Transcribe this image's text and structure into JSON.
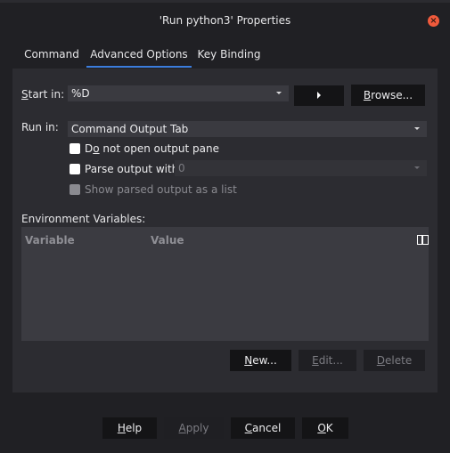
{
  "window": {
    "title": "'Run python3' Properties",
    "close_icon": "close-icon"
  },
  "tabs": [
    {
      "label": "Command",
      "active": false
    },
    {
      "label": "Advanced Options",
      "active": true
    },
    {
      "label": "Key Binding",
      "active": false
    }
  ],
  "start_in": {
    "label_pre": "",
    "label_mnemonic": "S",
    "label_post": "tart in:",
    "value": "%D",
    "arrow_button_icon": "play-arrow-icon",
    "browse_mnemonic": "B",
    "browse_rest": "rowse..."
  },
  "run_in": {
    "label": "Run in:",
    "value": "Command Output Tab"
  },
  "options": {
    "do_not_open": {
      "pre": "D",
      "mnemonic": "o",
      "post": " not open output pane",
      "checked": false
    },
    "parse_output": {
      "label": "Parse output with:",
      "checked": false,
      "value": "0"
    },
    "show_parsed": {
      "label": "Show parsed output as a list",
      "checked": false,
      "disabled": true
    }
  },
  "environment": {
    "label": "Environment Variables:",
    "columns": [
      "Variable",
      "Value"
    ],
    "rows": [],
    "columns_icon": "columns-icon",
    "buttons": {
      "new": {
        "mnemonic": "N",
        "rest": "ew..."
      },
      "edit": {
        "mnemonic": "E",
        "rest": "dit...",
        "disabled": true
      },
      "delete": {
        "mnemonic": "D",
        "rest": "elete",
        "disabled": true
      }
    }
  },
  "footer": {
    "help": {
      "mnemonic": "H",
      "rest": "elp"
    },
    "apply": {
      "mnemonic": "A",
      "rest": "pply",
      "disabled": true
    },
    "cancel": {
      "mnemonic": "C",
      "rest": "ancel"
    },
    "ok": {
      "mnemonic": "O",
      "rest": "K"
    }
  },
  "colors": {
    "accent": "#3b7ddd",
    "close": "#f05a3c",
    "background": "#202024",
    "panel": "#2c2c31"
  }
}
